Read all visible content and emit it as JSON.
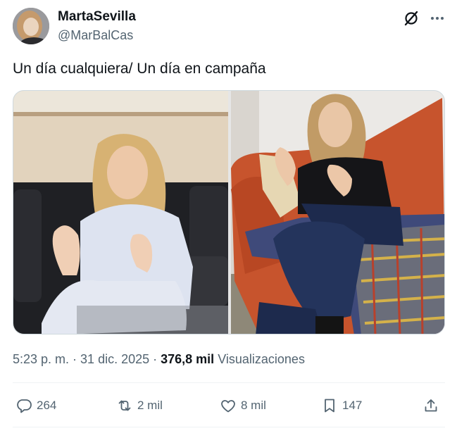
{
  "author": {
    "display_name": "MartaSevilla",
    "handle": "@MarBalCas"
  },
  "tweet": {
    "text": "Un día cualquiera/ Un día en campaña"
  },
  "meta": {
    "time": "5:23 p. m.",
    "separator": " · ",
    "date": "31 dic. 2025",
    "views_count": "376,8 mil",
    "views_label": "Visualizaciones"
  },
  "actions": {
    "replies": "264",
    "reposts": "2 mil",
    "likes": "8 mil",
    "bookmarks": "147"
  },
  "icons": {
    "grok": "grok-icon",
    "more": "more-icon",
    "reply": "reply-icon",
    "repost": "repost-icon",
    "like": "heart-icon",
    "bookmark": "bookmark-icon",
    "share": "share-icon"
  },
  "colors": {
    "text_primary": "#0f1419",
    "text_secondary": "#536471",
    "divider": "#eff3f4"
  }
}
